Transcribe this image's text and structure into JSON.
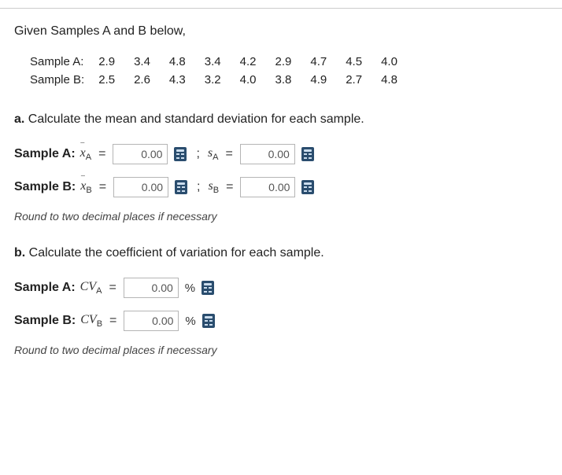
{
  "intro": "Given Samples A and B below,",
  "samples": {
    "a_label": "Sample A:",
    "b_label": "Sample B:",
    "a": [
      "2.9",
      "3.4",
      "4.8",
      "3.4",
      "4.2",
      "2.9",
      "4.7",
      "4.5",
      "4.0"
    ],
    "b": [
      "2.5",
      "2.6",
      "4.3",
      "3.2",
      "4.0",
      "3.8",
      "4.9",
      "2.7",
      "4.8"
    ]
  },
  "partA": {
    "prompt_prefix": "a.",
    "prompt_text": " Calculate the mean and standard deviation for each sample.",
    "sampleA_label": "Sample A:",
    "sampleB_label": "Sample B:",
    "mean_value": "0.00",
    "sd_value": "0.00",
    "meanB_value": "0.00",
    "sdB_value": "0.00",
    "semicolon": ";",
    "hint": "Round to two decimal places if necessary"
  },
  "partB": {
    "prompt_prefix": "b.",
    "prompt_text": " Calculate the coefficient of variation for each sample.",
    "sampleA_label": "Sample A:",
    "sampleB_label": "Sample B:",
    "cvA_value": "0.00",
    "cvB_value": "0.00",
    "pct": "%",
    "hint": "Round to two decimal places if necessary"
  }
}
